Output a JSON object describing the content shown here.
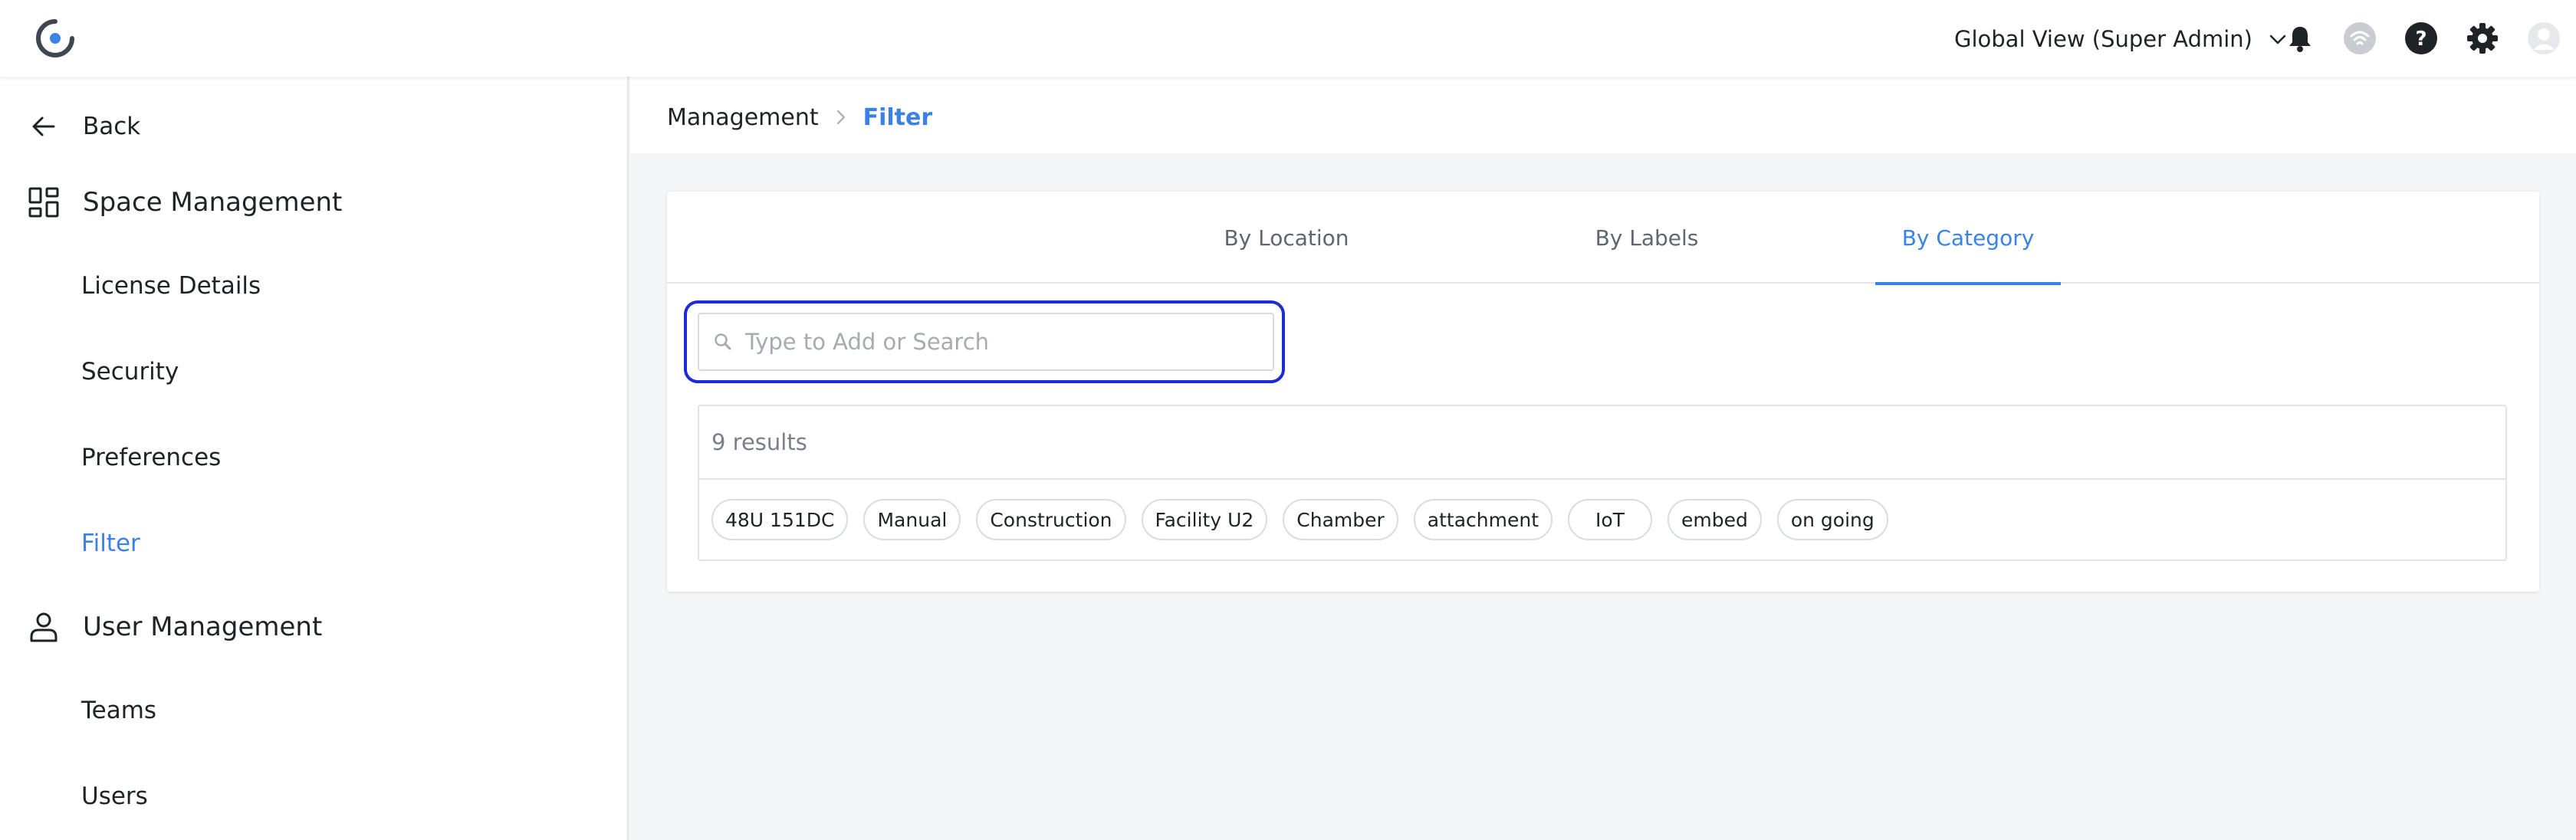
{
  "header": {
    "view_label": "Global View (Super Admin)",
    "icons": [
      "logo-icon",
      "chevron-down-icon",
      "bell-icon",
      "wifi-status-icon",
      "help-icon",
      "gear-icon",
      "user-avatar-icon"
    ]
  },
  "sidebar": {
    "back_label": "Back",
    "sections": [
      {
        "label": "Space Management",
        "icon": "dashboard-grid-icon",
        "items": [
          {
            "label": "License Details",
            "active": false
          },
          {
            "label": "Security",
            "active": false
          },
          {
            "label": "Preferences",
            "active": false
          },
          {
            "label": "Filter",
            "active": true
          }
        ]
      },
      {
        "label": "User Management",
        "icon": "person-icon",
        "items": [
          {
            "label": "Teams",
            "active": false
          },
          {
            "label": "Users",
            "active": false
          }
        ]
      }
    ]
  },
  "breadcrumb": {
    "items": [
      "Management",
      "Filter"
    ]
  },
  "tabs": [
    {
      "label": "By Location",
      "active": false
    },
    {
      "label": "By Labels",
      "active": false
    },
    {
      "label": "By Category",
      "active": true
    }
  ],
  "search": {
    "placeholder": "Type to Add or Search",
    "value": ""
  },
  "results": {
    "count_label": "9 results",
    "chips": [
      "48U 151DC",
      "Manual",
      "Construction",
      "Facility U2",
      "Chamber",
      "attachment",
      "IoT",
      "embed",
      "on going"
    ]
  },
  "colors": {
    "accent": "#3b82e6",
    "focus_ring": "#1a2bd8",
    "text": "#1f2328",
    "muted": "#7a8089",
    "page_bg": "#f4f5f7"
  }
}
